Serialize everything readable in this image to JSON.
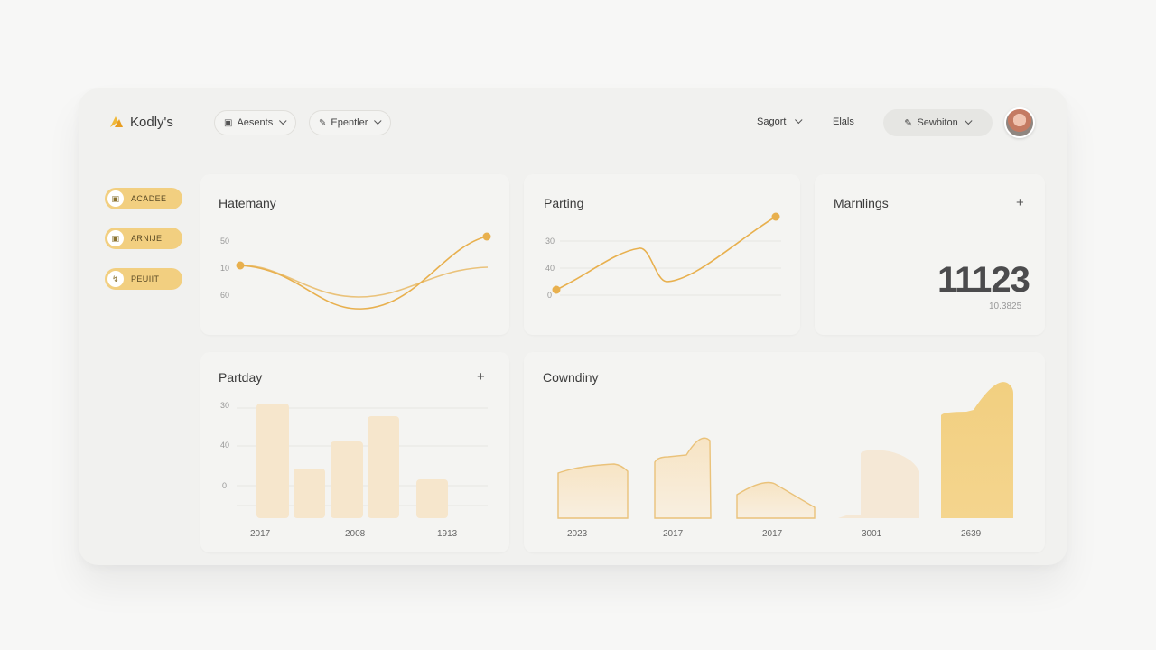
{
  "header": {
    "brand": "Kodly's",
    "pill_1": "Aesents",
    "pill_2": "Epentler",
    "link_1": "Sagort",
    "link_2": "Elals",
    "session": "Sewbiton"
  },
  "sidebar": {
    "items": [
      {
        "label": "ACADEE",
        "icon": "lock-icon"
      },
      {
        "label": "ARNIJE",
        "icon": "lock-icon"
      },
      {
        "label": "PEUIIT",
        "icon": "chart-icon"
      }
    ]
  },
  "colors": {
    "accent": "#f2cf80",
    "line": "#e8b04e",
    "bar_light": "#f6e6cc"
  },
  "cards": {
    "hatemany": {
      "title": "Hatemany",
      "ticks": [
        "50",
        "10",
        "60"
      ]
    },
    "parting": {
      "title": "Parting",
      "ticks": [
        "30",
        "40",
        "0"
      ]
    },
    "marnlings": {
      "title": "Marnlings",
      "value": "11123",
      "sub_value": "10.3825"
    },
    "partday": {
      "title": "Partday",
      "ticks": [
        "30",
        "40",
        "0"
      ],
      "categories": [
        "2017",
        "2008",
        "1913"
      ]
    },
    "cowndiny": {
      "title": "Cowndiny",
      "categories": [
        "2023",
        "2017",
        "2017",
        "3001",
        "2639"
      ]
    }
  },
  "chart_data": [
    {
      "type": "line",
      "title": "Hatemany",
      "series": [
        {
          "values": [
            32,
            18,
            4,
            12,
            55
          ]
        },
        {
          "values": [
            32,
            24,
            16,
            22,
            30
          ]
        }
      ]
    },
    {
      "type": "line",
      "title": "Parting",
      "series": [
        {
          "values": [
            5,
            28,
            45,
            12,
            32,
            86
          ]
        }
      ]
    },
    {
      "type": "bar",
      "title": "Partday",
      "values": [
        100,
        42,
        66,
        88,
        32
      ]
    },
    {
      "type": "area",
      "title": "Cowndiny",
      "categories": [
        "2023",
        "2017",
        "2017",
        "3001",
        "2639"
      ],
      "values": [
        40,
        68,
        30,
        58,
        100
      ]
    }
  ]
}
